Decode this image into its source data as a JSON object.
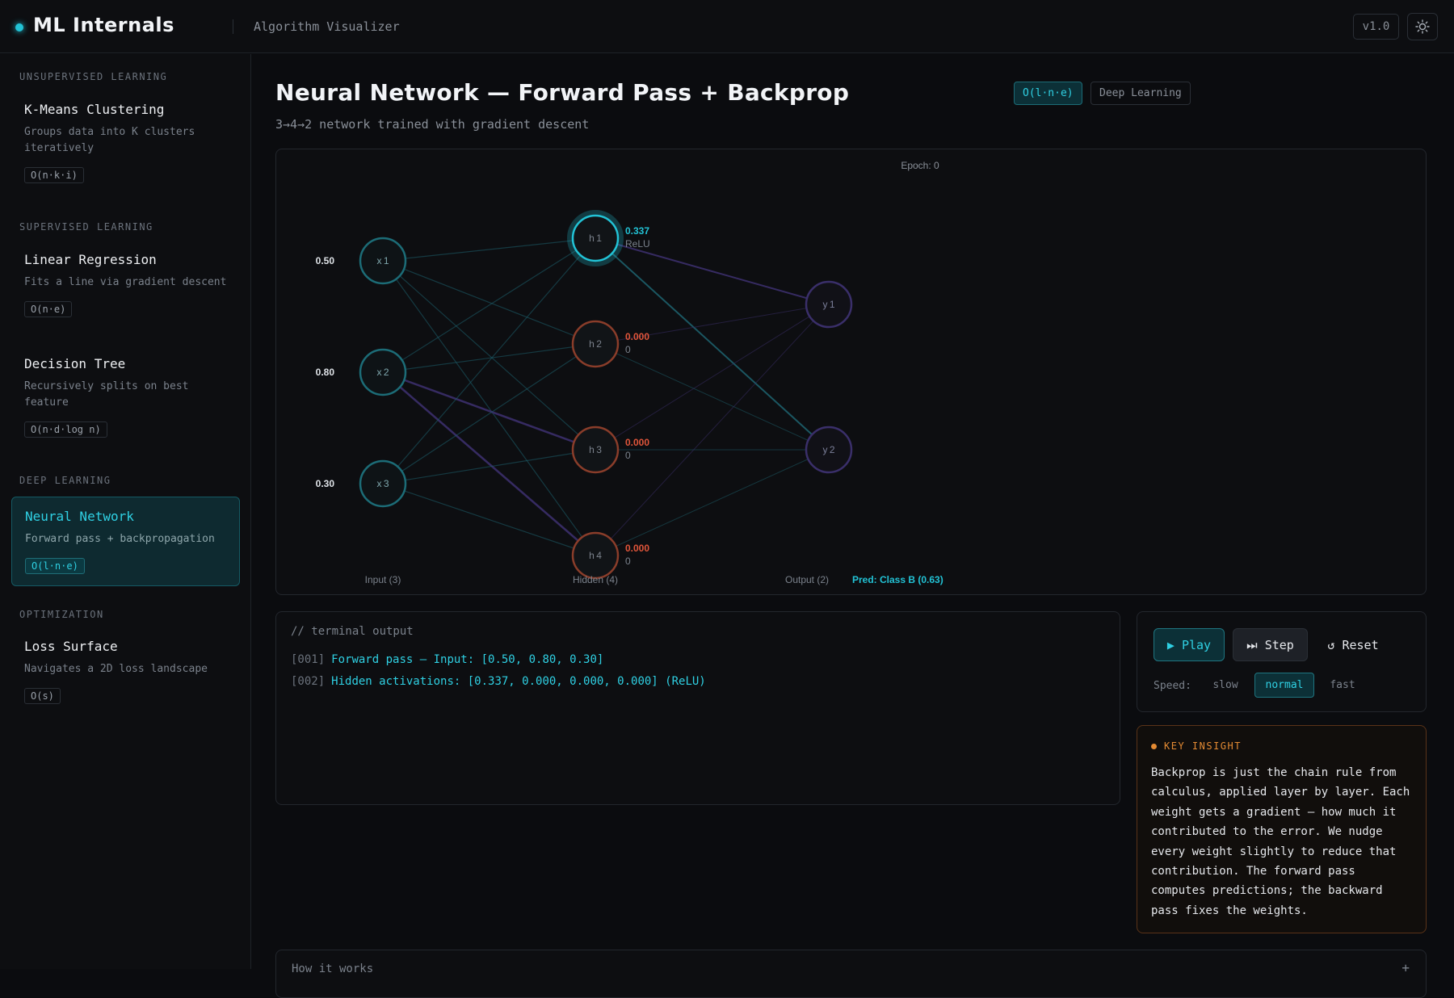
{
  "app": {
    "name": "ML Internals",
    "subtitle": "Algorithm Visualizer",
    "version": "v1.0",
    "theme_icon": "sun-icon",
    "accent": "#22c3d6"
  },
  "sidebar": {
    "sections": [
      {
        "title": "UNSUPERVISED LEARNING",
        "items": [
          {
            "name": "K-Means Clustering",
            "desc": "Groups data into K clusters iteratively",
            "complexity": "O(n·k·i)"
          }
        ]
      },
      {
        "title": "SUPERVISED LEARNING",
        "items": [
          {
            "name": "Linear Regression",
            "desc": "Fits a line via gradient descent",
            "complexity": "O(n·e)"
          },
          {
            "name": "Decision Tree",
            "desc": "Recursively splits on best feature",
            "complexity": "O(n·d·log n)"
          }
        ]
      },
      {
        "title": "DEEP LEARNING",
        "items": [
          {
            "name": "Neural Network",
            "desc": "Forward pass + backpropagation",
            "complexity": "O(l·n·e)",
            "active": true
          }
        ]
      },
      {
        "title": "OPTIMIZATION",
        "items": [
          {
            "name": "Loss Surface",
            "desc": "Navigates a 2D loss landscape",
            "complexity": "O(s)"
          }
        ]
      }
    ]
  },
  "main": {
    "title": "Neural Network — Forward Pass + Backprop",
    "complexity": "O(l·n·e)",
    "category": "Deep Learning",
    "subtitle": "3→4→2 network trained with gradient descent"
  },
  "network": {
    "epoch_label": "Epoch: 0",
    "inputs": [
      {
        "label": "x1",
        "value": "0.50"
      },
      {
        "label": "x2",
        "value": "0.80"
      },
      {
        "label": "x3",
        "value": "0.30"
      }
    ],
    "hidden": [
      {
        "label": "h1",
        "activation": "0.337",
        "note": "ReLU"
      },
      {
        "label": "h2",
        "activation": "0.000",
        "note": "0"
      },
      {
        "label": "h3",
        "activation": "0.000",
        "note": "0"
      },
      {
        "label": "h4",
        "activation": "0.000",
        "note": "0"
      }
    ],
    "outputs": [
      {
        "label": "y1"
      },
      {
        "label": "y2"
      }
    ],
    "layer_labels": {
      "input": "Input (3)",
      "hidden": "Hidden (4)",
      "output": "Output (2)"
    },
    "prediction": "Pred: Class B (0.63)",
    "colors": {
      "input_ring": "#1c6c77",
      "active_ring": "#22c3d6",
      "inactive_ring": "#8a3d2a",
      "output_ring": "#3a2f6a",
      "positive_weight": "#1d5f6b",
      "negative_weight": "#3b2f6b",
      "activation_positive": "#22c3d6",
      "activation_zero": "#e0553a"
    }
  },
  "terminal": {
    "title": "// terminal output",
    "lines": [
      {
        "idx": "[001]",
        "text": "Forward pass — Input: [0.50, 0.80, 0.30]"
      },
      {
        "idx": "[002]",
        "text": "Hidden activations: [0.337, 0.000, 0.000, 0.000] (ReLU)"
      }
    ]
  },
  "controls": {
    "play": "▶ Play",
    "step": "⏭ Step",
    "reset": "↺ Reset",
    "speed_label": "Speed:",
    "speeds": [
      "slow",
      "normal",
      "fast"
    ],
    "selected_speed": "normal"
  },
  "insight": {
    "title": "KEY INSIGHT",
    "text": "Backprop is just the chain rule from calculus, applied layer by layer. Each weight gets a gradient — how much it contributed to the error. We nudge every weight slightly to reduce that contribution. The forward pass computes predictions; the backward pass fixes the weights.",
    "color": "#e38a33"
  },
  "how_it_works": {
    "label": "How it works",
    "toggle": "+"
  }
}
